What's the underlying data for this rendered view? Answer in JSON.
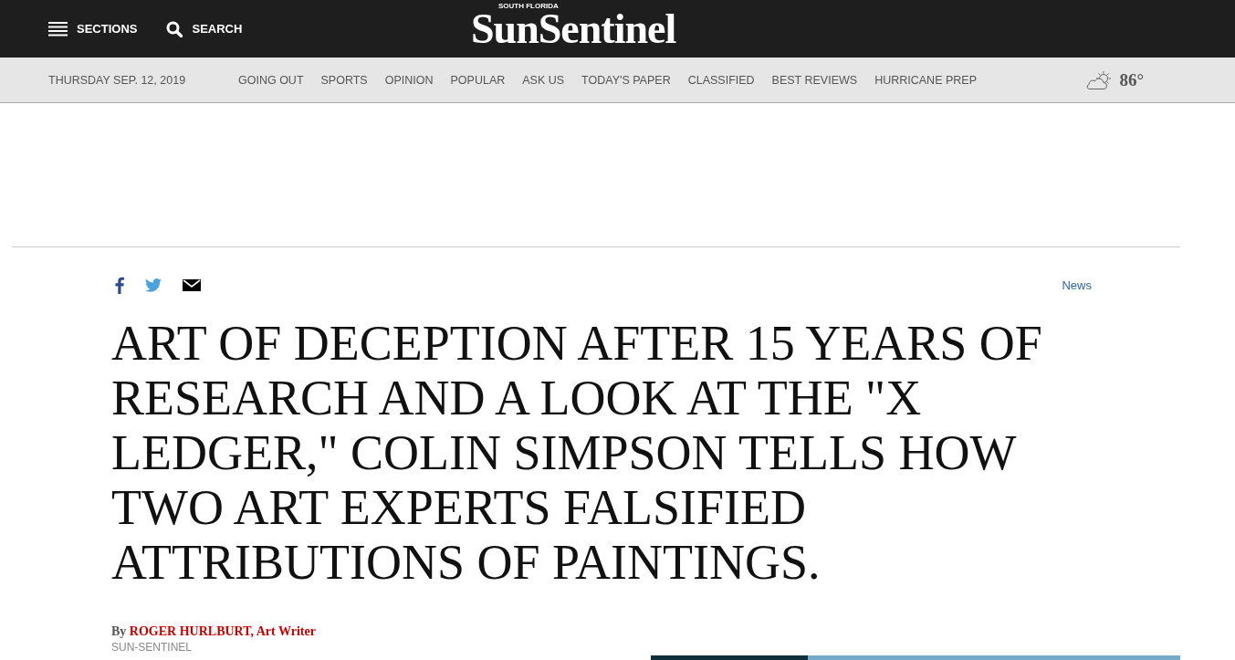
{
  "header": {
    "sections_label": "SECTIONS",
    "search_label": "SEARCH",
    "logo_kicker": "SOUTH FLORIDA",
    "logo": "SunSentinel"
  },
  "nav": {
    "date": "THURSDAY SEP. 12, 2019",
    "links": [
      "GOING OUT",
      "SPORTS",
      "OPINION",
      "POPULAR",
      "ASK US",
      "TODAY'S PAPER",
      "CLASSIFIED",
      "BEST REVIEWS",
      "HURRICANE PREP"
    ],
    "temperature": "86°"
  },
  "article": {
    "category": "News",
    "headline": "ART OF DECEPTION AFTER 15 YEARS OF RESEARCH AND A LOOK AT THE \"X LEDGER,\" COLIN SIMPSON TELLS HOW TWO ART EXPERTS FALSIFIED ATTRIBUTIONS OF PAINTINGS.",
    "byline": "By **ROGER HURLBURT, Art Writer**",
    "source": "SUN-SENTINEL"
  }
}
